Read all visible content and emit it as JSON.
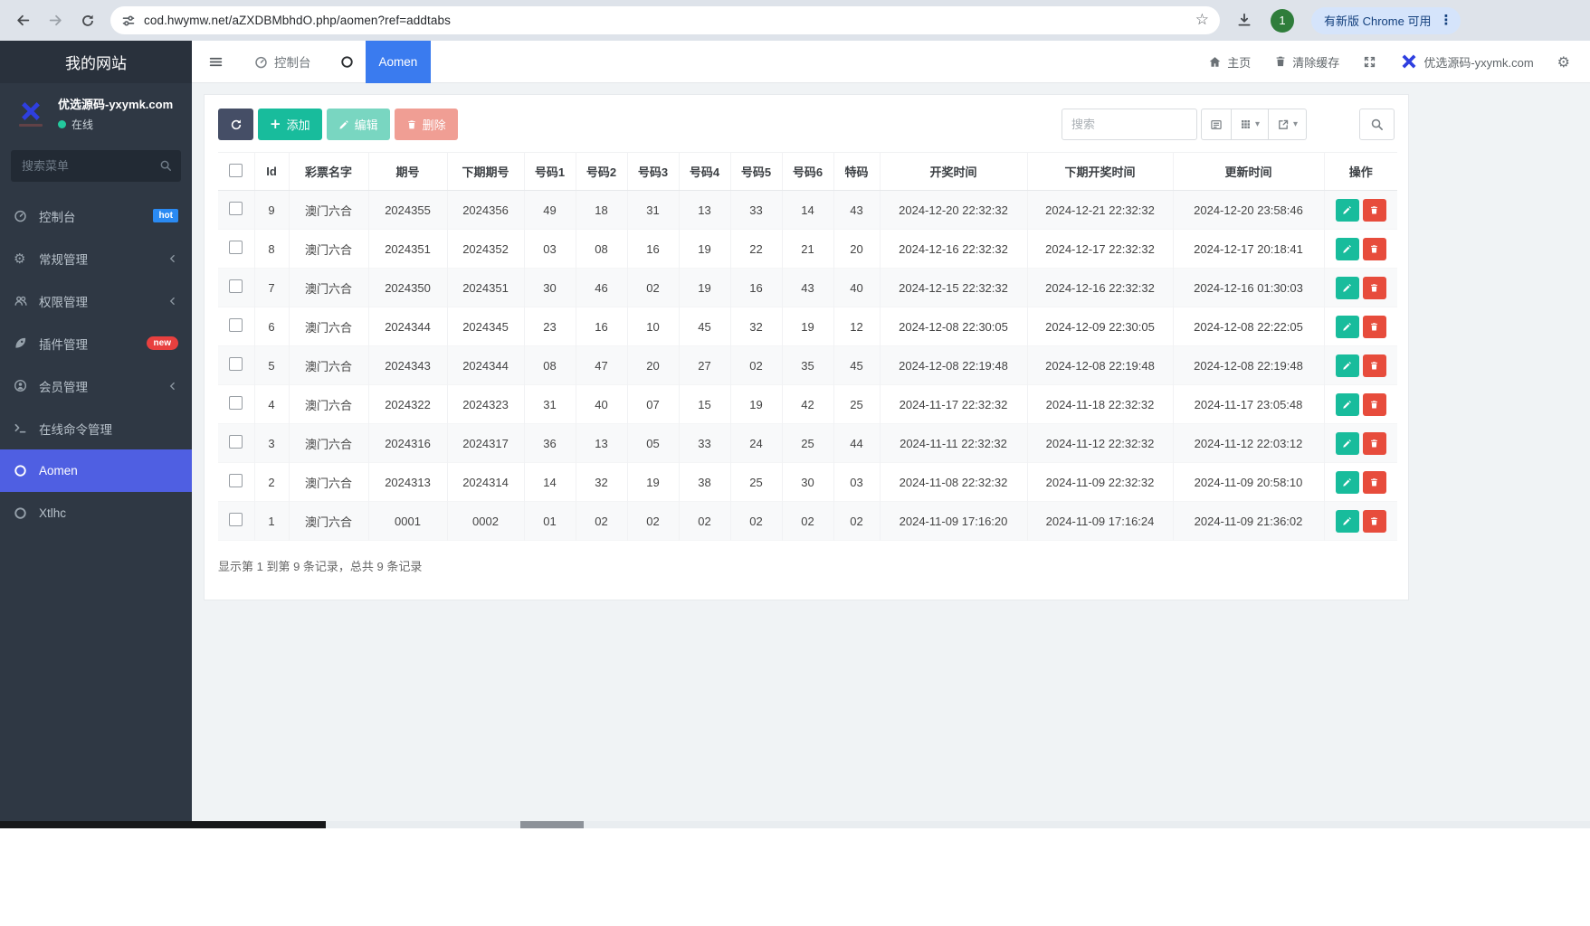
{
  "browser": {
    "url": "cod.hwymw.net/aZXDBMbhdO.php/aomen?ref=addtabs",
    "profile_badge": "1",
    "update_button": "有新版 Chrome 可用"
  },
  "icons": {
    "caret_down": "▾",
    "star": "☆",
    "more_vertical": "⋮",
    "gear": "⚙",
    "plus": "+"
  },
  "sidebar": {
    "site_title": "我的网站",
    "user_name": "优选源码-yxymk.com",
    "user_status": "在线",
    "search_placeholder": "搜索菜单",
    "items": [
      {
        "label": "控制台",
        "badge": "hot"
      },
      {
        "label": "常规管理"
      },
      {
        "label": "权限管理"
      },
      {
        "label": "插件管理",
        "badge": "new"
      },
      {
        "label": "会员管理"
      },
      {
        "label": "在线命令管理"
      },
      {
        "label": "Aomen",
        "active": true
      },
      {
        "label": "Xtlhc"
      }
    ]
  },
  "topbar": {
    "tabs": [
      {
        "label": "控制台"
      },
      {
        "label": "Aomen",
        "active": true
      }
    ],
    "home_label": "主页",
    "clear_cache_label": "清除缓存",
    "site_label": "优选源码-yxymk.com"
  },
  "toolbar": {
    "add_label": "添加",
    "edit_label": "编辑",
    "delete_label": "删除",
    "search_placeholder": "搜索"
  },
  "table": {
    "columns": [
      "Id",
      "彩票名字",
      "期号",
      "下期期号",
      "号码1",
      "号码2",
      "号码3",
      "号码4",
      "号码5",
      "号码6",
      "特码",
      "开奖时间",
      "下期开奖时间",
      "更新时间",
      "操作"
    ],
    "rows": [
      [
        "9",
        "澳门六合",
        "2024355",
        "2024356",
        "49",
        "18",
        "31",
        "13",
        "33",
        "14",
        "43",
        "2024-12-20 22:32:32",
        "2024-12-21 22:32:32",
        "2024-12-20 23:58:46"
      ],
      [
        "8",
        "澳门六合",
        "2024351",
        "2024352",
        "03",
        "08",
        "16",
        "19",
        "22",
        "21",
        "20",
        "2024-12-16 22:32:32",
        "2024-12-17 22:32:32",
        "2024-12-17 20:18:41"
      ],
      [
        "7",
        "澳门六合",
        "2024350",
        "2024351",
        "30",
        "46",
        "02",
        "19",
        "16",
        "43",
        "40",
        "2024-12-15 22:32:32",
        "2024-12-16 22:32:32",
        "2024-12-16 01:30:03"
      ],
      [
        "6",
        "澳门六合",
        "2024344",
        "2024345",
        "23",
        "16",
        "10",
        "45",
        "32",
        "19",
        "12",
        "2024-12-08 22:30:05",
        "2024-12-09 22:30:05",
        "2024-12-08 22:22:05"
      ],
      [
        "5",
        "澳门六合",
        "2024343",
        "2024344",
        "08",
        "47",
        "20",
        "27",
        "02",
        "35",
        "45",
        "2024-12-08 22:19:48",
        "2024-12-08 22:19:48",
        "2024-12-08 22:19:48"
      ],
      [
        "4",
        "澳门六合",
        "2024322",
        "2024323",
        "31",
        "40",
        "07",
        "15",
        "19",
        "42",
        "25",
        "2024-11-17 22:32:32",
        "2024-11-18 22:32:32",
        "2024-11-17 23:05:48"
      ],
      [
        "3",
        "澳门六合",
        "2024316",
        "2024317",
        "36",
        "13",
        "05",
        "33",
        "24",
        "25",
        "44",
        "2024-11-11 22:32:32",
        "2024-11-12 22:32:32",
        "2024-11-12 22:03:12"
      ],
      [
        "2",
        "澳门六合",
        "2024313",
        "2024314",
        "14",
        "32",
        "19",
        "38",
        "25",
        "30",
        "03",
        "2024-11-08 22:32:32",
        "2024-11-09 22:32:32",
        "2024-11-09 20:58:10"
      ],
      [
        "1",
        "澳门六合",
        "0001",
        "0002",
        "01",
        "02",
        "02",
        "02",
        "02",
        "02",
        "02",
        "2024-11-09 17:16:20",
        "2024-11-09 17:16:24",
        "2024-11-09 21:36:02"
      ]
    ],
    "summary": "显示第 1 到第 9 条记录，总共 9 条记录"
  },
  "colors": {
    "sidebar_bg": "#2f3844",
    "sidebar_active": "#4f5fe2",
    "tab_active": "#3a7bef",
    "success": "#18bc9c",
    "danger": "#e74c3c",
    "refresh_btn": "#454e66",
    "hot_badge": "#2a8af3",
    "new_badge": "#e8403f",
    "online_dot": "#23c99d"
  }
}
